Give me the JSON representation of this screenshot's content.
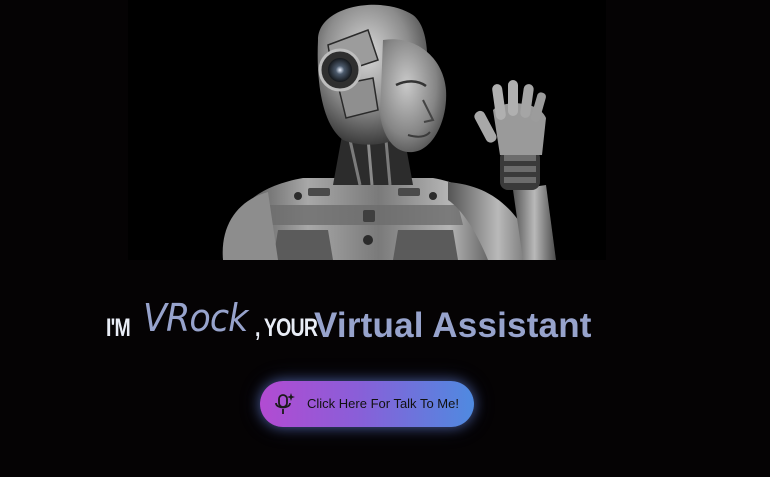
{
  "hero": {
    "image_alt": "humanoid-robot-waving",
    "icon": "robot-image"
  },
  "headline": {
    "prefix": "I'M",
    "name": "VRock",
    "connector": ", YOUR",
    "title": "Virtual Assistant"
  },
  "talk_button": {
    "label": "Click Here For Talk To Me!",
    "icon": "microphone-icon"
  },
  "colors": {
    "background": "#050304",
    "headline_accent": "#97a3cc",
    "headline_light": "#e9edf6",
    "button_gradient_start": "#b24bd2",
    "button_gradient_end": "#4f8ae0"
  }
}
